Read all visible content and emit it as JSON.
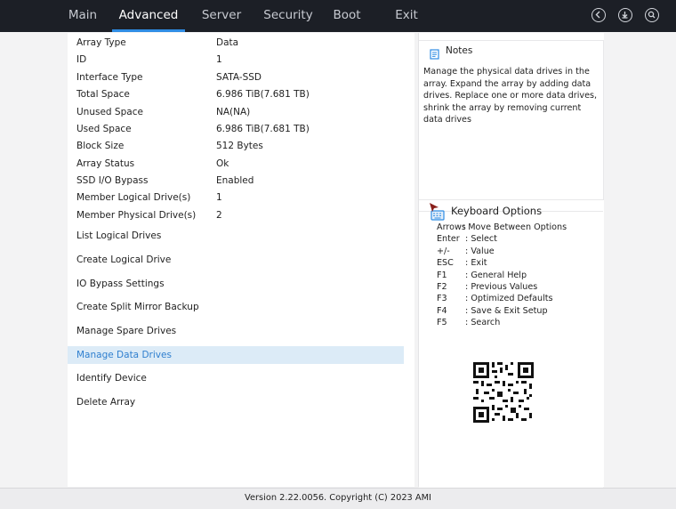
{
  "nav": {
    "tabs": [
      {
        "label": "Main"
      },
      {
        "label": "Advanced"
      },
      {
        "label": "Server"
      },
      {
        "label": "Security"
      },
      {
        "label": "Boot"
      },
      {
        "label": "Exit"
      }
    ],
    "active_tab": "Advanced",
    "icons": [
      "back-icon",
      "download-icon",
      "search-icon"
    ]
  },
  "array_info": [
    {
      "label": "Array Type",
      "value": "Data"
    },
    {
      "label": "ID",
      "value": "1"
    },
    {
      "label": "Interface Type",
      "value": "SATA-SSD"
    },
    {
      "label": "Total Space",
      "value": "6.986 TiB(7.681 TB)"
    },
    {
      "label": "Unused Space",
      "value": "NA(NA)"
    },
    {
      "label": "Used Space",
      "value": "6.986 TiB(7.681 TB)"
    },
    {
      "label": "Block Size",
      "value": "512 Bytes"
    },
    {
      "label": "Array Status",
      "value": "Ok"
    },
    {
      "label": "SSD I/O Bypass",
      "value": "Enabled"
    },
    {
      "label": "Member Logical Drive(s)",
      "value": "1"
    },
    {
      "label": "Member Physical Drive(s)",
      "value": "2"
    }
  ],
  "menu": [
    {
      "label": "List Logical Drives"
    },
    {
      "label": "Create Logical Drive"
    },
    {
      "label": "IO Bypass Settings"
    },
    {
      "label": "Create Split Mirror Backup"
    },
    {
      "label": "Manage Spare Drives"
    },
    {
      "label": "Manage Data Drives"
    },
    {
      "label": "Identify Device"
    },
    {
      "label": "Delete Array"
    }
  ],
  "selected_menu": "Manage Data Drives",
  "notes": {
    "title": "Notes",
    "text": "Manage the physical data drives in the array. Expand the array by adding data drives. Replace one or more data drives, shrink the array by removing current data drives"
  },
  "keyboard": {
    "title": "Keyboard Options",
    "options": [
      {
        "key": "Arrows",
        "desc": ": Move Between Options"
      },
      {
        "key": "Enter",
        "desc": "  : Select"
      },
      {
        "key": "+/-",
        "desc": "     : Value"
      },
      {
        "key": "ESC",
        "desc": "   : Exit"
      },
      {
        "key": "F1",
        "desc": "     : General Help"
      },
      {
        "key": "F2",
        "desc": "     : Previous Values"
      },
      {
        "key": "F3",
        "desc": "     : Optimized Defaults"
      },
      {
        "key": "F4",
        "desc": "     : Save & Exit Setup"
      },
      {
        "key": "F5",
        "desc": "     : Search"
      }
    ]
  },
  "footer": "Version 2.22.0056. Copyright (C) 2023 AMI",
  "colors": {
    "topbar": "#1c1f26",
    "accent": "#2f8de4",
    "selected_bg": "#dcebf7",
    "selected_text": "#2f7fcf"
  }
}
